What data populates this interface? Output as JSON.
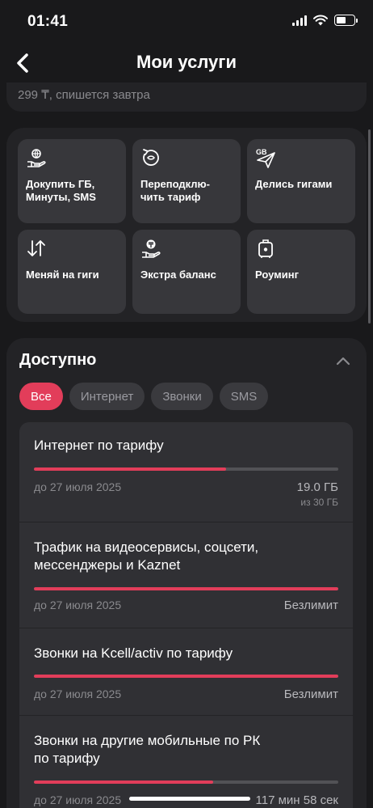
{
  "status_bar": {
    "time": "01:41"
  },
  "header": {
    "title": "Мои услуги"
  },
  "previous_card": {
    "text": "299 ₸, спишется завтра"
  },
  "services": [
    {
      "label": "Докупить ГБ,\nМинуты, SMS",
      "icon": "globe-hand-icon"
    },
    {
      "label": "Переподклю-\nчить тариф",
      "icon": "refresh-circle-icon"
    },
    {
      "label": "Делись гигами",
      "icon": "gb-paper-plane-icon"
    },
    {
      "label": "Меняй на гиги",
      "icon": "swap-arrows-icon"
    },
    {
      "label": "Экстра баланс",
      "icon": "tenge-coin-hand-icon"
    },
    {
      "label": "Роуминг",
      "icon": "suitcase-icon"
    }
  ],
  "available": {
    "title": "Доступно",
    "filters": [
      {
        "label": "Все",
        "active": true
      },
      {
        "label": "Интернет",
        "active": false
      },
      {
        "label": "Звонки",
        "active": false
      },
      {
        "label": "SMS",
        "active": false
      }
    ],
    "items": [
      {
        "title": "Интернет по тарифу",
        "date": "до 27 июля 2025",
        "amount": "19.0 ГБ",
        "total": "из 30 ГБ",
        "progress": 0.63
      },
      {
        "title": "Трафик на видеосервисы, соцсети,\nмессенджеры и Kaznet",
        "date": "до 27 июля 2025",
        "amount": "Безлимит",
        "total": "",
        "progress": 1.0
      },
      {
        "title": "Звонки на Kcell/activ по тарифу",
        "date": "до 27 июля 2025",
        "amount": "Безлимит",
        "total": "",
        "progress": 1.0
      },
      {
        "title": "Звонки на другие мобильные по РК\nпо тарифу",
        "date": "до 27 июля 2025",
        "amount": "117 мин 58 сек",
        "total": "",
        "progress": 0.59
      }
    ]
  },
  "colors": {
    "accent": "#e23d5a",
    "background": "#19191b",
    "card": "#232326",
    "tile": "#37373b"
  }
}
